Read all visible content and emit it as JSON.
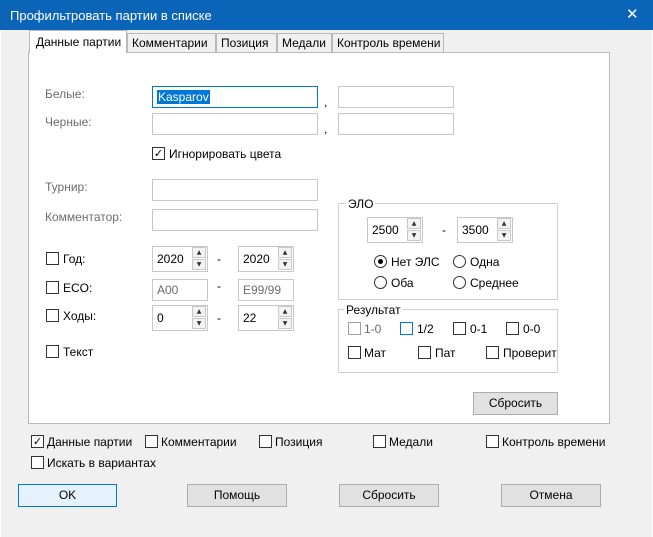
{
  "window": {
    "title": "Профильтровать партии в списке",
    "close_glyph": "✕"
  },
  "tabs": [
    "Данные партии",
    "Комментарии",
    "Позиция",
    "Медали",
    "Контроль времени"
  ],
  "players": {
    "white_label": "Белые:",
    "white_value": "Kasparov",
    "white_second": "",
    "black_label": "Черные:",
    "black_value": "",
    "black_second": "",
    "separator": ",",
    "ignore_colors_label": "Игнорировать цвета",
    "ignore_colors_checked": true
  },
  "event": {
    "tournament_label": "Турнир:",
    "tournament_value": "",
    "annotator_label": "Комментатор:",
    "annotator_value": ""
  },
  "filters": {
    "year_label": "Год:",
    "year_from": "2020",
    "year_to": "2020",
    "eco_label": "ECO:",
    "eco_from": "A00",
    "eco_to": "E99/99",
    "moves_label": "Ходы:",
    "moves_from": "0",
    "moves_to": "22",
    "text_label": "Текст",
    "range_sep": "-"
  },
  "elo": {
    "label": "ЭЛО",
    "from": "2500",
    "to": "3500",
    "range_sep": "-",
    "options": [
      "Нет ЭЛС",
      "Одна",
      "Оба",
      "Среднее"
    ],
    "selected": "Нет ЭЛС"
  },
  "result": {
    "label": "Результат",
    "scores": [
      "1-0",
      "1/2",
      "0-1",
      "0-0"
    ],
    "types": [
      "Мат",
      "Пат",
      "Проверит"
    ]
  },
  "reset_label": "Сбросить",
  "include": {
    "items": [
      "Данные партии",
      "Комментарии",
      "Позиция",
      "Медали",
      "Контроль времени"
    ],
    "checked": [
      "Данные партии"
    ],
    "variations_label": "Искать в вариантах"
  },
  "buttons": {
    "ok": "OK",
    "help": "Помощь",
    "reset": "Сбросить",
    "cancel": "Отмена"
  },
  "icons": {
    "check": "✓",
    "spin_up": "▲",
    "spin_down": "▼"
  }
}
